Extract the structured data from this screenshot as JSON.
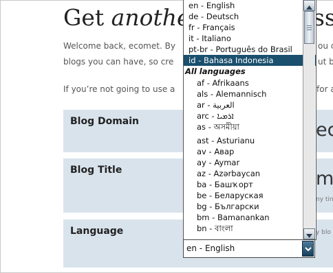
{
  "header": {
    "title_start": "Get ",
    "title_italic": "anothe",
    "title_end": "ss"
  },
  "intro": {
    "line1": "Welcome back, ecomet. By",
    "line1_right": "ou c",
    "line2": "blogs you can have, so cre",
    "line2_right": "ut b",
    "line3": "If you’re not going to use a",
    "line3_right": "for a"
  },
  "form": {
    "blog_domain_label": "Blog Domain",
    "blog_domain_fragment": "ec",
    "blog_title_label": "Blog Title",
    "blog_title_fragment": "mp",
    "blog_title_hint": "ny tin",
    "language_label": "Language",
    "language_hint": "y blo"
  },
  "language_select": {
    "selected_value": "en - English",
    "options": [
      {
        "label": "en - English",
        "type": "option"
      },
      {
        "label": "de - Deutsch",
        "type": "option"
      },
      {
        "label": "fr - Français",
        "type": "option"
      },
      {
        "label": "it - Italiano",
        "type": "option"
      },
      {
        "label": "pt-br - Português do Brasil",
        "type": "option"
      },
      {
        "label": "id - Bahasa Indonesia",
        "type": "option",
        "highlighted": true
      },
      {
        "label": "All languages",
        "type": "group"
      },
      {
        "label": "af - Afrikaans",
        "type": "option",
        "indent": true
      },
      {
        "label": "als - Alemannisch",
        "type": "option",
        "indent": true
      },
      {
        "label": "ar - العربية",
        "type": "option",
        "indent": true
      },
      {
        "label": "arc - ܐܪܡܝܐ",
        "type": "option",
        "indent": true
      },
      {
        "label": "as - অসমীয়া",
        "type": "option",
        "indent": true
      },
      {
        "label": "ast - Asturianu",
        "type": "option",
        "indent": true,
        "gap": true
      },
      {
        "label": "av - Авар",
        "type": "option",
        "indent": true
      },
      {
        "label": "ay - Aymar",
        "type": "option",
        "indent": true
      },
      {
        "label": "az - Azərbaycan",
        "type": "option",
        "indent": true
      },
      {
        "label": "ba - Башҡорт",
        "type": "option",
        "indent": true
      },
      {
        "label": "be - Беларуская",
        "type": "option",
        "indent": true
      },
      {
        "label": "bg - Български",
        "type": "option",
        "indent": true
      },
      {
        "label": "bm - Bamanankan",
        "type": "option",
        "indent": true
      },
      {
        "label": "bn - বাংলা",
        "type": "option",
        "indent": true
      }
    ]
  },
  "icons": {
    "scroll_up": "triangle-up-icon",
    "scroll_down": "triangle-down-icon",
    "select_arrow": "chevron-down-icon"
  },
  "colors": {
    "form_row_bg": "#d9e3ec",
    "highlight": "#1a4f6d"
  }
}
